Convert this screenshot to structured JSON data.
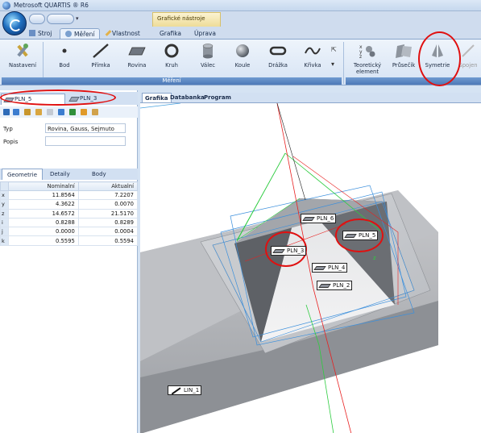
{
  "window": {
    "title": "Metrosoft QUARTIS ® R6"
  },
  "contextual_tab": "Grafické nástroje",
  "tabs": [
    {
      "label": "Stroj"
    },
    {
      "label": "Měření"
    },
    {
      "label": "Vlastnost"
    },
    {
      "label": "Grafika"
    },
    {
      "label": "Úprava"
    }
  ],
  "ribbon": {
    "buttons": [
      {
        "label": "Nastavení",
        "icon": "tools-icon"
      },
      {
        "label": "Bod",
        "icon": "point-icon"
      },
      {
        "label": "Přímka",
        "icon": "line-icon"
      },
      {
        "label": "Rovina",
        "icon": "plane-icon"
      },
      {
        "label": "Kruh",
        "icon": "circle-icon"
      },
      {
        "label": "Válec",
        "icon": "cylinder-icon"
      },
      {
        "label": "Koule",
        "icon": "sphere-icon"
      },
      {
        "label": "Drážka",
        "icon": "slot-icon"
      },
      {
        "label": "Křivka",
        "icon": "curve-icon"
      },
      {
        "label": "Teoretický element",
        "icon": "xyz-icon"
      },
      {
        "label": "Průsečík",
        "icon": "intersection-icon"
      },
      {
        "label": "Symetrie",
        "icon": "symmetry-icon"
      },
      {
        "label": "Spojen",
        "icon": "connect-icon"
      }
    ],
    "group_label": "Měření"
  },
  "left_panel": {
    "tabs": [
      {
        "label": "PLN_5"
      },
      {
        "label": "PLN_3"
      }
    ],
    "type_label": "Typ",
    "type_value": "Rovina, Gauss, Sejmuto",
    "desc_label": "Popis",
    "desc_value": "",
    "geo_tabs": [
      {
        "label": "Geometrie"
      },
      {
        "label": "Detaily"
      },
      {
        "label": "Body"
      }
    ],
    "table": {
      "headers": [
        "Nominalní",
        "Aktualní"
      ],
      "rows": [
        {
          "k": "x",
          "nominal": "11.8564",
          "actual": "7.2207"
        },
        {
          "k": "y",
          "nominal": "4.3622",
          "actual": "0.0070"
        },
        {
          "k": "z",
          "nominal": "14.6572",
          "actual": "21.5170"
        },
        {
          "k": "i",
          "nominal": "0.8288",
          "actual": "0.8289"
        },
        {
          "k": "j",
          "nominal": "0.0000",
          "actual": "0.0004"
        },
        {
          "k": "k",
          "nominal": "0.5595",
          "actual": "0.5594"
        }
      ]
    }
  },
  "view_tabs": [
    {
      "label": "Grafika"
    },
    {
      "label": "Databanka"
    },
    {
      "label": "Program"
    }
  ],
  "features": {
    "pln6": "PLN_6",
    "pln5": "PLN_5",
    "pln3": "PLN_3",
    "pln4": "PLN_4",
    "pln2": "PLN_2",
    "lin1": "LIN_1"
  },
  "colors": {
    "highlight": "#e01010",
    "accent": "#4d79b7"
  }
}
